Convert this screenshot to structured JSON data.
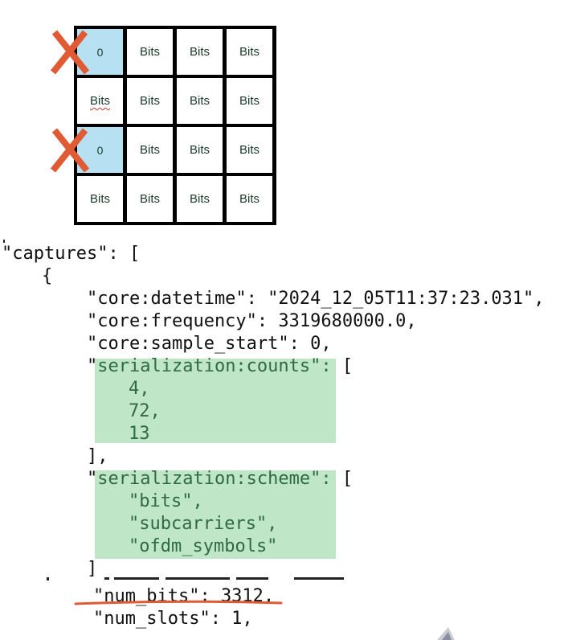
{
  "grid": {
    "rows": [
      [
        "0",
        "Bits",
        "Bits",
        "Bits"
      ],
      [
        "Bits",
        "Bits",
        "Bits",
        "Bits"
      ],
      [
        "0",
        "Bits",
        "Bits",
        "Bits"
      ],
      [
        "Bits",
        "Bits",
        "Bits",
        "Bits"
      ]
    ],
    "crossed_rows": [
      0,
      2
    ],
    "zero_cell_color": "#b7e1f3",
    "cross_color": "#e05a33"
  },
  "code": {
    "line_captures": "\"captures\": [",
    "line_open": "{",
    "line_datetime": "\"core:datetime\": \"2024_12_05T11:37:23.031\",",
    "line_frequency": "\"core:frequency\": 3319680000.0,",
    "line_sample_start": "\"core:sample_start\": 0,",
    "counts_quote": "\"",
    "counts_key": "serialization:counts\":",
    "counts_bracket": " [",
    "counts_values": [
      "4,",
      "72,",
      "13"
    ],
    "counts_close": "],",
    "scheme_quote": "\"",
    "scheme_key": "serialization:scheme\":",
    "scheme_bracket": " [",
    "scheme_values": [
      "\"bits\",",
      "\"subcarriers\",",
      "\"ofdm_symbols\""
    ],
    "scheme_close": "]",
    "line_num_bits": "\"num_bits\": 3312,",
    "line_num_slots": "\"num_slots\": 1,",
    "highlight_color": "#bfe6c6",
    "underline_color": "#e05a33"
  }
}
